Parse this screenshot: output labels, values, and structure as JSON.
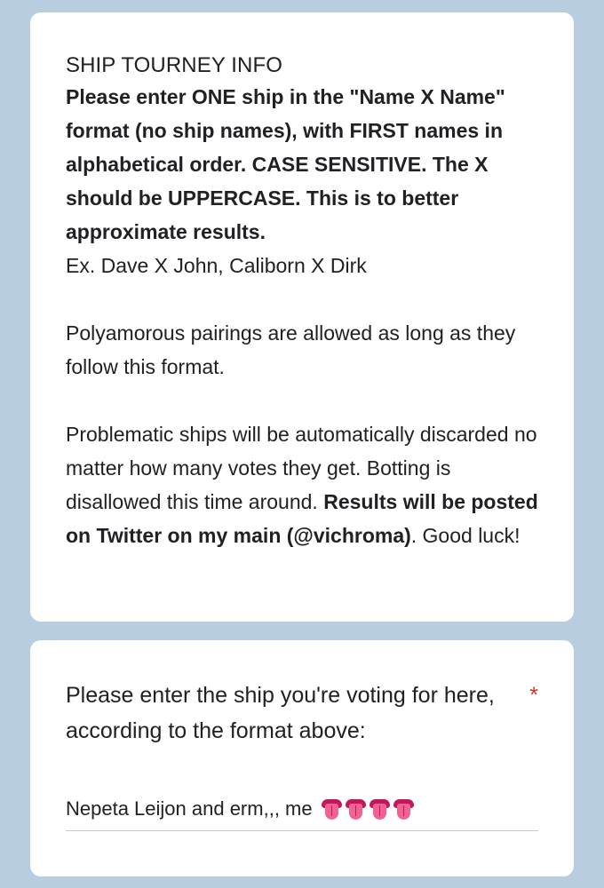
{
  "info_card": {
    "title": "SHIP TOURNEY INFO",
    "bold_intro": "Please enter ONE ship in the \"Name X Name\" format (no ship names), with FIRST names in alphabetical order. CASE SENSITIVE. The X should be UPPERCASE. This is to better approximate results.",
    "example": "Ex. Dave X John, Caliborn X Dirk",
    "poly_note": "Polyamorous pairings are allowed as long as they follow this format.",
    "problem_text": "Problematic ships will be automatically discarded no matter how many votes they get. Botting is disallowed this time around. ",
    "results_bold": "Results will be posted on Twitter on my main (@vichroma)",
    "good_luck": ". Good luck!"
  },
  "question_card": {
    "question": "Please enter the ship you're voting for here, according to the format above:",
    "required_marker": "*",
    "answer_value": "Nepeta Leijon and erm,,, me",
    "answer_emoji": [
      "tongue-icon",
      "tongue-icon",
      "tongue-icon",
      "tongue-icon"
    ]
  },
  "colors": {
    "background": "#b8cde0",
    "card": "#ffffff",
    "required": "#d93025"
  }
}
